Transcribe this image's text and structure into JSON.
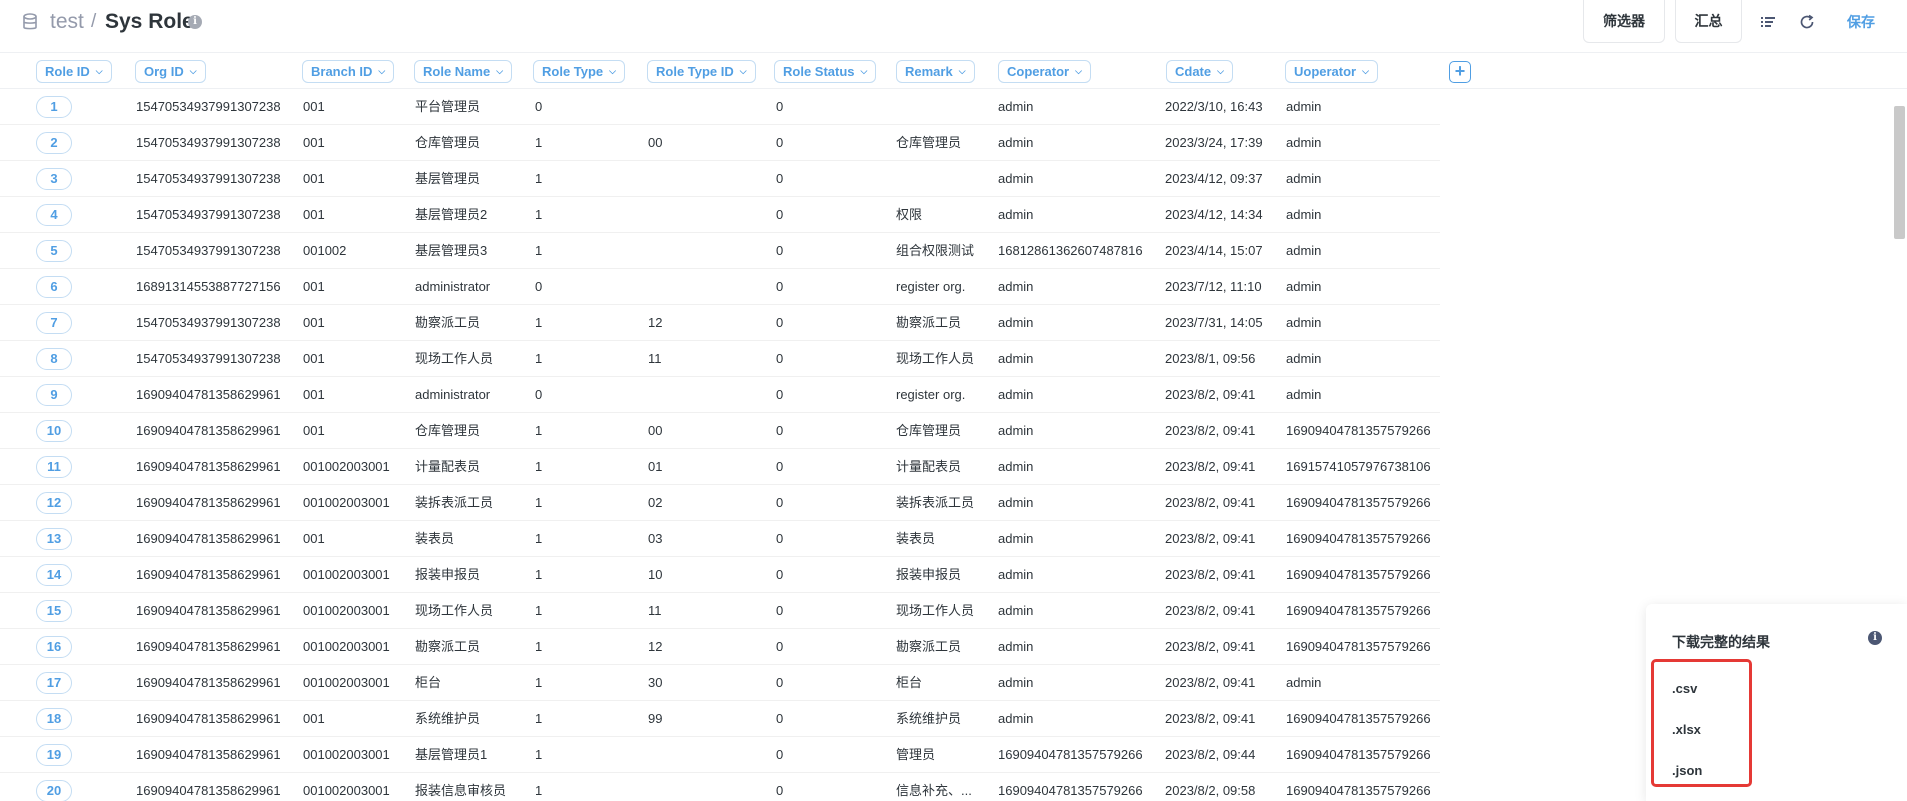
{
  "header": {
    "crumb": "test",
    "separator": "/",
    "title": "Sys Role",
    "filter_label": "筛选器",
    "summarize_label": "汇总",
    "save_label": "保存"
  },
  "columns": [
    "Role ID",
    "Org ID",
    "Branch ID",
    "Role Name",
    "Role Type",
    "Role Type ID",
    "Role Status",
    "Remark",
    "Coperator",
    "Cdate",
    "Uoperator"
  ],
  "rows": [
    [
      "1",
      "1547053493799130723​8",
      "001",
      "平台管理员",
      "0",
      "",
      "0",
      "",
      "admin",
      "2022/3/10, 16:43",
      "admin"
    ],
    [
      "2",
      "15470534937991307238",
      "001",
      "仓库管理员",
      "1",
      "00",
      "0",
      "仓库管理员",
      "admin",
      "2023/3/24, 17:39",
      "admin"
    ],
    [
      "3",
      "15470534937991307238",
      "001",
      "基层管理员",
      "1",
      "",
      "0",
      "",
      "admin",
      "2023/4/12, 09:37",
      "admin"
    ],
    [
      "4",
      "15470534937991307238",
      "001",
      "基层管理员2",
      "1",
      "",
      "0",
      "权限",
      "admin",
      "2023/4/12, 14:34",
      "admin"
    ],
    [
      "5",
      "15470534937991307238",
      "001002",
      "基层管理员3",
      "1",
      "",
      "0",
      "组合权限测试",
      "16812861362607487816",
      "2023/4/14, 15:07",
      "admin"
    ],
    [
      "6",
      "16891314553887727156",
      "001",
      "administrator",
      "0",
      "",
      "0",
      "register org.",
      "admin",
      "2023/7/12, 11:10",
      "admin"
    ],
    [
      "7",
      "15470534937991307238",
      "001",
      "勘察派工员",
      "1",
      "12",
      "0",
      "勘察派工员",
      "admin",
      "2023/7/31, 14:05",
      "admin"
    ],
    [
      "8",
      "15470534937991307238",
      "001",
      "现场工作人员",
      "1",
      "11",
      "0",
      "现场工作人员",
      "admin",
      "2023/8/1, 09:56",
      "admin"
    ],
    [
      "9",
      "16909404781358629961",
      "001",
      "administrator",
      "0",
      "",
      "0",
      "register org.",
      "admin",
      "2023/8/2, 09:41",
      "admin"
    ],
    [
      "10",
      "16909404781358629961",
      "001",
      "仓库管理员",
      "1",
      "00",
      "0",
      "仓库管理员",
      "admin",
      "2023/8/2, 09:41",
      "16909404781357579266"
    ],
    [
      "11",
      "16909404781358629961",
      "001002003001",
      "计量配表员",
      "1",
      "01",
      "0",
      "计量配表员",
      "admin",
      "2023/8/2, 09:41",
      "16915741057976738106"
    ],
    [
      "12",
      "16909404781358629961",
      "001002003001",
      "装拆表派工员",
      "1",
      "02",
      "0",
      "装拆表派工员",
      "admin",
      "2023/8/2, 09:41",
      "16909404781357579266"
    ],
    [
      "13",
      "16909404781358629961",
      "001",
      "装表员",
      "1",
      "03",
      "0",
      "装表员",
      "admin",
      "2023/8/2, 09:41",
      "16909404781357579266"
    ],
    [
      "14",
      "16909404781358629961",
      "001002003001",
      "报装申报员",
      "1",
      "10",
      "0",
      "报装申报员",
      "admin",
      "2023/8/2, 09:41",
      "16909404781357579266"
    ],
    [
      "15",
      "16909404781358629961",
      "001002003001",
      "现场工作人员",
      "1",
      "11",
      "0",
      "现场工作人员",
      "admin",
      "2023/8/2, 09:41",
      "16909404781357579266"
    ],
    [
      "16",
      "16909404781358629961",
      "001002003001",
      "勘察派工员",
      "1",
      "12",
      "0",
      "勘察派工员",
      "admin",
      "2023/8/2, 09:41",
      "16909404781357579266"
    ],
    [
      "17",
      "16909404781358629961",
      "001002003001",
      "柜台",
      "1",
      "30",
      "0",
      "柜台",
      "admin",
      "2023/8/2, 09:41",
      "admin"
    ],
    [
      "18",
      "16909404781358629961",
      "001",
      "系统维护员",
      "1",
      "99",
      "0",
      "系统维护员",
      "admin",
      "2023/8/2, 09:41",
      "16909404781357579266"
    ],
    [
      "19",
      "16909404781358629961",
      "001002003001",
      "基层管理员1",
      "1",
      "",
      "0",
      "管理员",
      "16909404781357579266",
      "2023/8/2, 09:44",
      "16909404781357579266"
    ],
    [
      "20",
      "16909404781358629961",
      "001002003001",
      "报装信息审核员",
      "1",
      "",
      "0",
      "信息补充、...",
      "16909404781357579266",
      "2023/8/2, 09:58",
      "16909404781357579266"
    ]
  ],
  "download": {
    "title": "下载完整的结果",
    "formats": [
      ".csv",
      ".xlsx",
      ".json"
    ]
  },
  "colors": {
    "brand": "#509ee3",
    "text": "#2e353b",
    "highlight": "#e53935"
  }
}
